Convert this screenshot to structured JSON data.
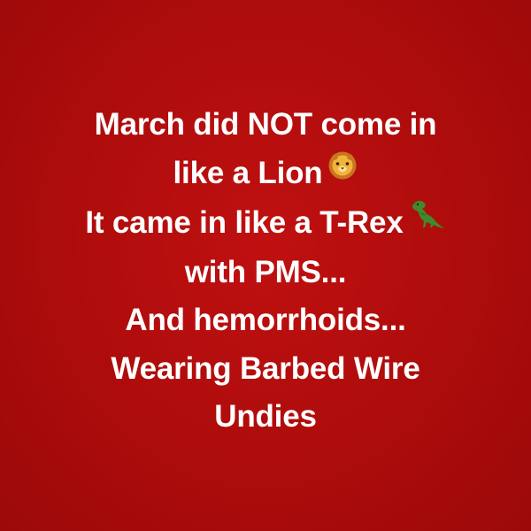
{
  "background_color": "#b30d0d",
  "text_color": "#ffffff",
  "lines": [
    "March did NOT come in",
    "like a Lion",
    "It came in like a T-Rex",
    "with PMS...",
    "And hemorrhoids...",
    "Wearing Barbed Wire",
    "Undies"
  ],
  "icons": {
    "lion": "lion-face-emoji",
    "trex": "t-rex-emoji"
  }
}
